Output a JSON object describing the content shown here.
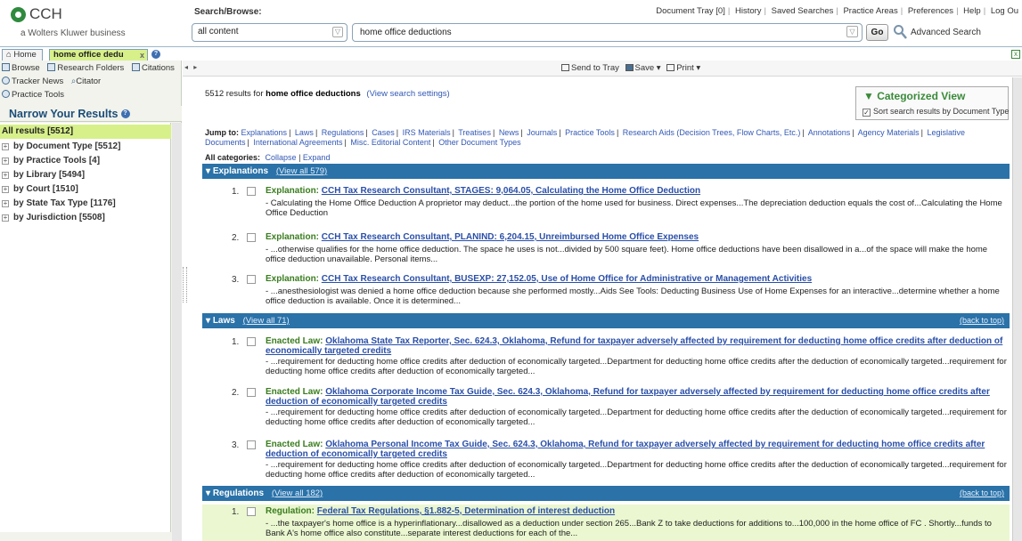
{
  "header": {
    "logo_name": "CCH",
    "logo_sub": "a Wolters Kluwer business",
    "search_label": "Search/Browse:",
    "scope_value": "all content",
    "search_value": "home office deductions",
    "go_label": "Go",
    "advanced_label": "Advanced Search",
    "top_links": [
      "Document Tray [0]",
      "History",
      "Saved Searches",
      "Practice Areas",
      "Preferences",
      "Help",
      "Log Ou"
    ]
  },
  "tabs": {
    "home_label": "Home",
    "query_label": "home office dedu",
    "close_glyph": "x"
  },
  "sidebar": {
    "toolbar": {
      "browse": "Browse",
      "research_folders": "Research Folders",
      "citations": "Citations",
      "tracker_news": "Tracker News",
      "citator": "Citator",
      "practice_tools": "Practice Tools"
    },
    "narrow_title": "Narrow Your Results",
    "all_results": "All results [5512]",
    "facets": [
      "by Document Type [5512]",
      "by Practice Tools [4]",
      "by Library [5494]",
      "by Court [1510]",
      "by State Tax Type [1176]",
      "by Jurisdiction [5508]"
    ]
  },
  "content_toolbar": {
    "send_to_tray": "Send to Tray",
    "save": "Save ▾",
    "print": "Print ▾"
  },
  "results_header": {
    "count": "5512",
    "count_text": " results for ",
    "query": "home office deductions",
    "view_settings": "(View search settings)"
  },
  "categorized_view": {
    "title": "Categorized View",
    "checkbox_label": "Sort search results by Document Type"
  },
  "jump_to": {
    "label": "Jump to:",
    "links": [
      "Explanations",
      "Laws",
      "Regulations",
      "Cases",
      "IRS Materials",
      "Treatises",
      "News",
      "Journals",
      "Practice Tools",
      "Research Aids (Decision Trees, Flow Charts, Etc.)",
      "Annotations",
      "Agency Materials",
      "Legislative Documents",
      "International Agreements",
      "Misc. Editorial Content",
      "Other Document Types"
    ]
  },
  "all_categories": {
    "label": "All categories:",
    "collapse": "Collapse",
    "expand": "Expand"
  },
  "sections": {
    "explanations": {
      "title": "Explanations",
      "view_all": "(View all 579)",
      "results": [
        {
          "num": "1.",
          "type": "Explanation:",
          "link": "CCH Tax Research Consultant, STAGES: 9,064.05, Calculating the Home Office Deduction",
          "snippet": "- Calculating the Home Office Deduction A proprietor may deduct...the portion of the home used for business. Direct expenses...The depreciation deduction equals the cost of...Calculating the Home Office Deduction"
        },
        {
          "num": "2.",
          "type": "Explanation:",
          "link": "CCH Tax Research Consultant, PLANIND: 6,204.15, Unreimbursed Home Office Expenses",
          "snippet": "- ...otherwise qualifies for the home office deduction. The space he uses is not...divided by 500 square feet). Home office deductions have been disallowed in a...of the space will make the home office deduction unavailable. Personal items..."
        },
        {
          "num": "3.",
          "type": "Explanation:",
          "link": "CCH Tax Research Consultant, BUSEXP: 27,152.05, Use of Home Office for Administrative or Management Activities",
          "snippet": "- ...anesthesiologist was denied a home office deduction because she performed mostly...Aids See Tools: Deducting Business Use of Home Expenses for an interactive...determine whether a home office deduction is available. Once it is determined..."
        }
      ]
    },
    "laws": {
      "title": "Laws",
      "view_all": "(View all 71)",
      "back_to_top": "(back to top)",
      "results": [
        {
          "num": "1.",
          "type": "Enacted Law:",
          "link": "Oklahoma State Tax Reporter, Sec. 624.3, Oklahoma, Refund for taxpayer adversely affected by requirement for deducting home office credits after deduction of economically targeted credits",
          "snippet": "- ...requirement for deducting home office credits after deduction of economically targeted...Department for deducting home office credits after the deduction of economically targeted...requirement for deducting home office credits after deduction of economically targeted..."
        },
        {
          "num": "2.",
          "type": "Enacted Law:",
          "link": "Oklahoma Corporate Income Tax Guide, Sec. 624.3, Oklahoma, Refund for taxpayer adversely affected by requirement for deducting home office credits after deduction of economically targeted credits",
          "snippet": "- ...requirement for deducting home office credits after deduction of economically targeted...Department for deducting home office credits after the deduction of economically targeted...requirement for deducting home office credits after deduction of economically targeted..."
        },
        {
          "num": "3.",
          "type": "Enacted Law:",
          "link": "Oklahoma Personal Income Tax Guide, Sec. 624.3, Oklahoma, Refund for taxpayer adversely affected by requirement for deducting home office credits after deduction of economically targeted credits",
          "snippet": "- ...requirement for deducting home office credits after deduction of economically targeted...Department for deducting home office credits after the deduction of economically targeted...requirement for deducting home office credits after deduction of economically targeted..."
        }
      ]
    },
    "regulations": {
      "title": "Regulations",
      "view_all": "(View all 182)",
      "back_to_top": "(back to top)",
      "results": [
        {
          "num": "1.",
          "type": "Regulation:",
          "link": "Federal Tax Regulations, §1.882-5, Determination of interest deduction",
          "snippet": "- ...the taxpayer's home office is a hyperinflationary...disallowed as a deduction under section 265...Bank Z to take deductions for additions to...100,000 in the home office of FC . Shortly...funds to Bank A's home office also constitute...separate interest deductions for each of the..."
        }
      ]
    }
  },
  "colors": {
    "section_bar": "#2a72a8",
    "active_tab": "#d7f08a",
    "link": "#2a4fa8",
    "result_type": "#3a7d1e"
  }
}
